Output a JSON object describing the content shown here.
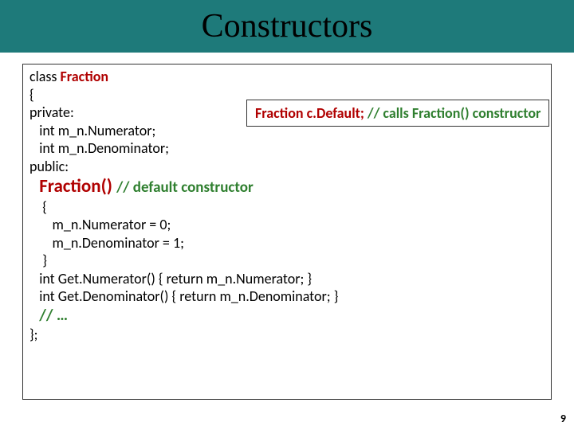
{
  "title": "Constructors",
  "code": {
    "l0_a": "class ",
    "l0_b": "Fraction",
    "l1": "{",
    "l2": "private:",
    "l3": "   int m_n.Numerator;",
    "l4": "   int m_n.Denominator;",
    "l5": "",
    "l6": "public:",
    "l7_a": "Fraction() ",
    "l7_b": "// default constructor",
    "l8": "    {",
    "l9": "       m_n.Numerator = 0;",
    "l10": "       m_n.Denominator = 1;",
    "l11": "    }",
    "l12": "",
    "l13": "   int Get.Numerator() { return m_n.Numerator; }",
    "l14": "   int Get.Denominator() { return m_n.Denominator; }",
    "l15": "// …",
    "l16": "};"
  },
  "callout": {
    "a": "Fraction c.Default; ",
    "b": "// calls Fraction() constructor"
  },
  "page_number": "9"
}
